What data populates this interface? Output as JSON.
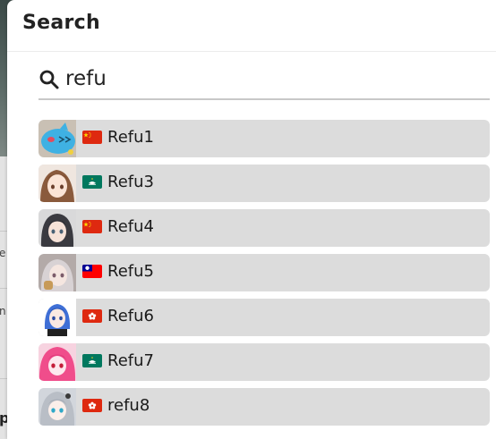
{
  "modal": {
    "title": "Search"
  },
  "search": {
    "value": "refu",
    "icon": "search-icon"
  },
  "background_fragments": [
    "e",
    "n",
    "p"
  ],
  "results": [
    {
      "name": "Refu1",
      "flag": "china",
      "avatar": "blue-mascot"
    },
    {
      "name": "Refu3",
      "flag": "macau",
      "avatar": "anime-girl-brown-hair"
    },
    {
      "name": "Refu4",
      "flag": "china",
      "avatar": "anime-girl-dark-hair"
    },
    {
      "name": "Refu5",
      "flag": "taiwan",
      "avatar": "anime-girl-gray-hair"
    },
    {
      "name": "Refu6",
      "flag": "hong-kong",
      "avatar": "anime-girl-blue-hair"
    },
    {
      "name": "Refu7",
      "flag": "macau",
      "avatar": "anime-girl-pink-hair"
    },
    {
      "name": "refu8",
      "flag": "hong-kong",
      "avatar": "anime-girl-silver-hair"
    }
  ],
  "colors": {
    "item_bg": "#dcdcdc",
    "china_red": "#de2910",
    "macau_green": "#00785e",
    "taiwan_blue": "#000095",
    "hong_kong_red": "#de2910"
  }
}
